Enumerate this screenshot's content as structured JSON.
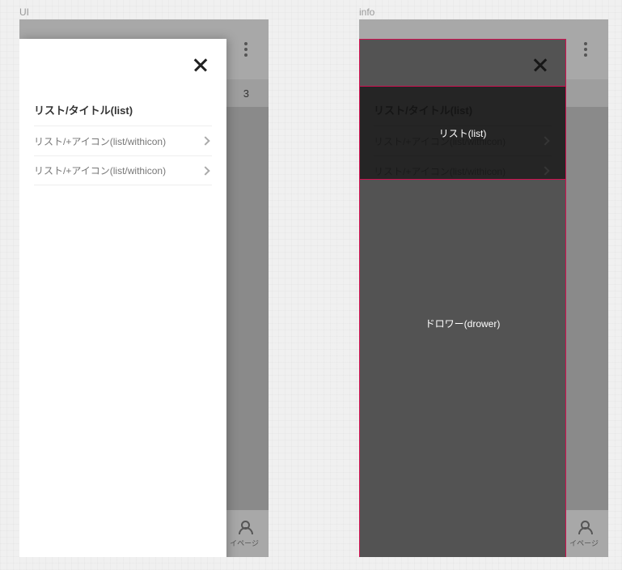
{
  "panels": {
    "ui_label": "UI",
    "info_label": "info"
  },
  "drawer": {
    "list_title": "リスト/タイトル(list)",
    "items": [
      {
        "label": "リスト/+アイコン(list/withicon)"
      },
      {
        "label": "リスト/+アイコン(list/withicon)"
      }
    ]
  },
  "background": {
    "tab_partial": "3",
    "nav_label": "イページ"
  },
  "info_overlay": {
    "list_label": "リスト(list)",
    "drawer_label": "ドロワー(drower)"
  }
}
